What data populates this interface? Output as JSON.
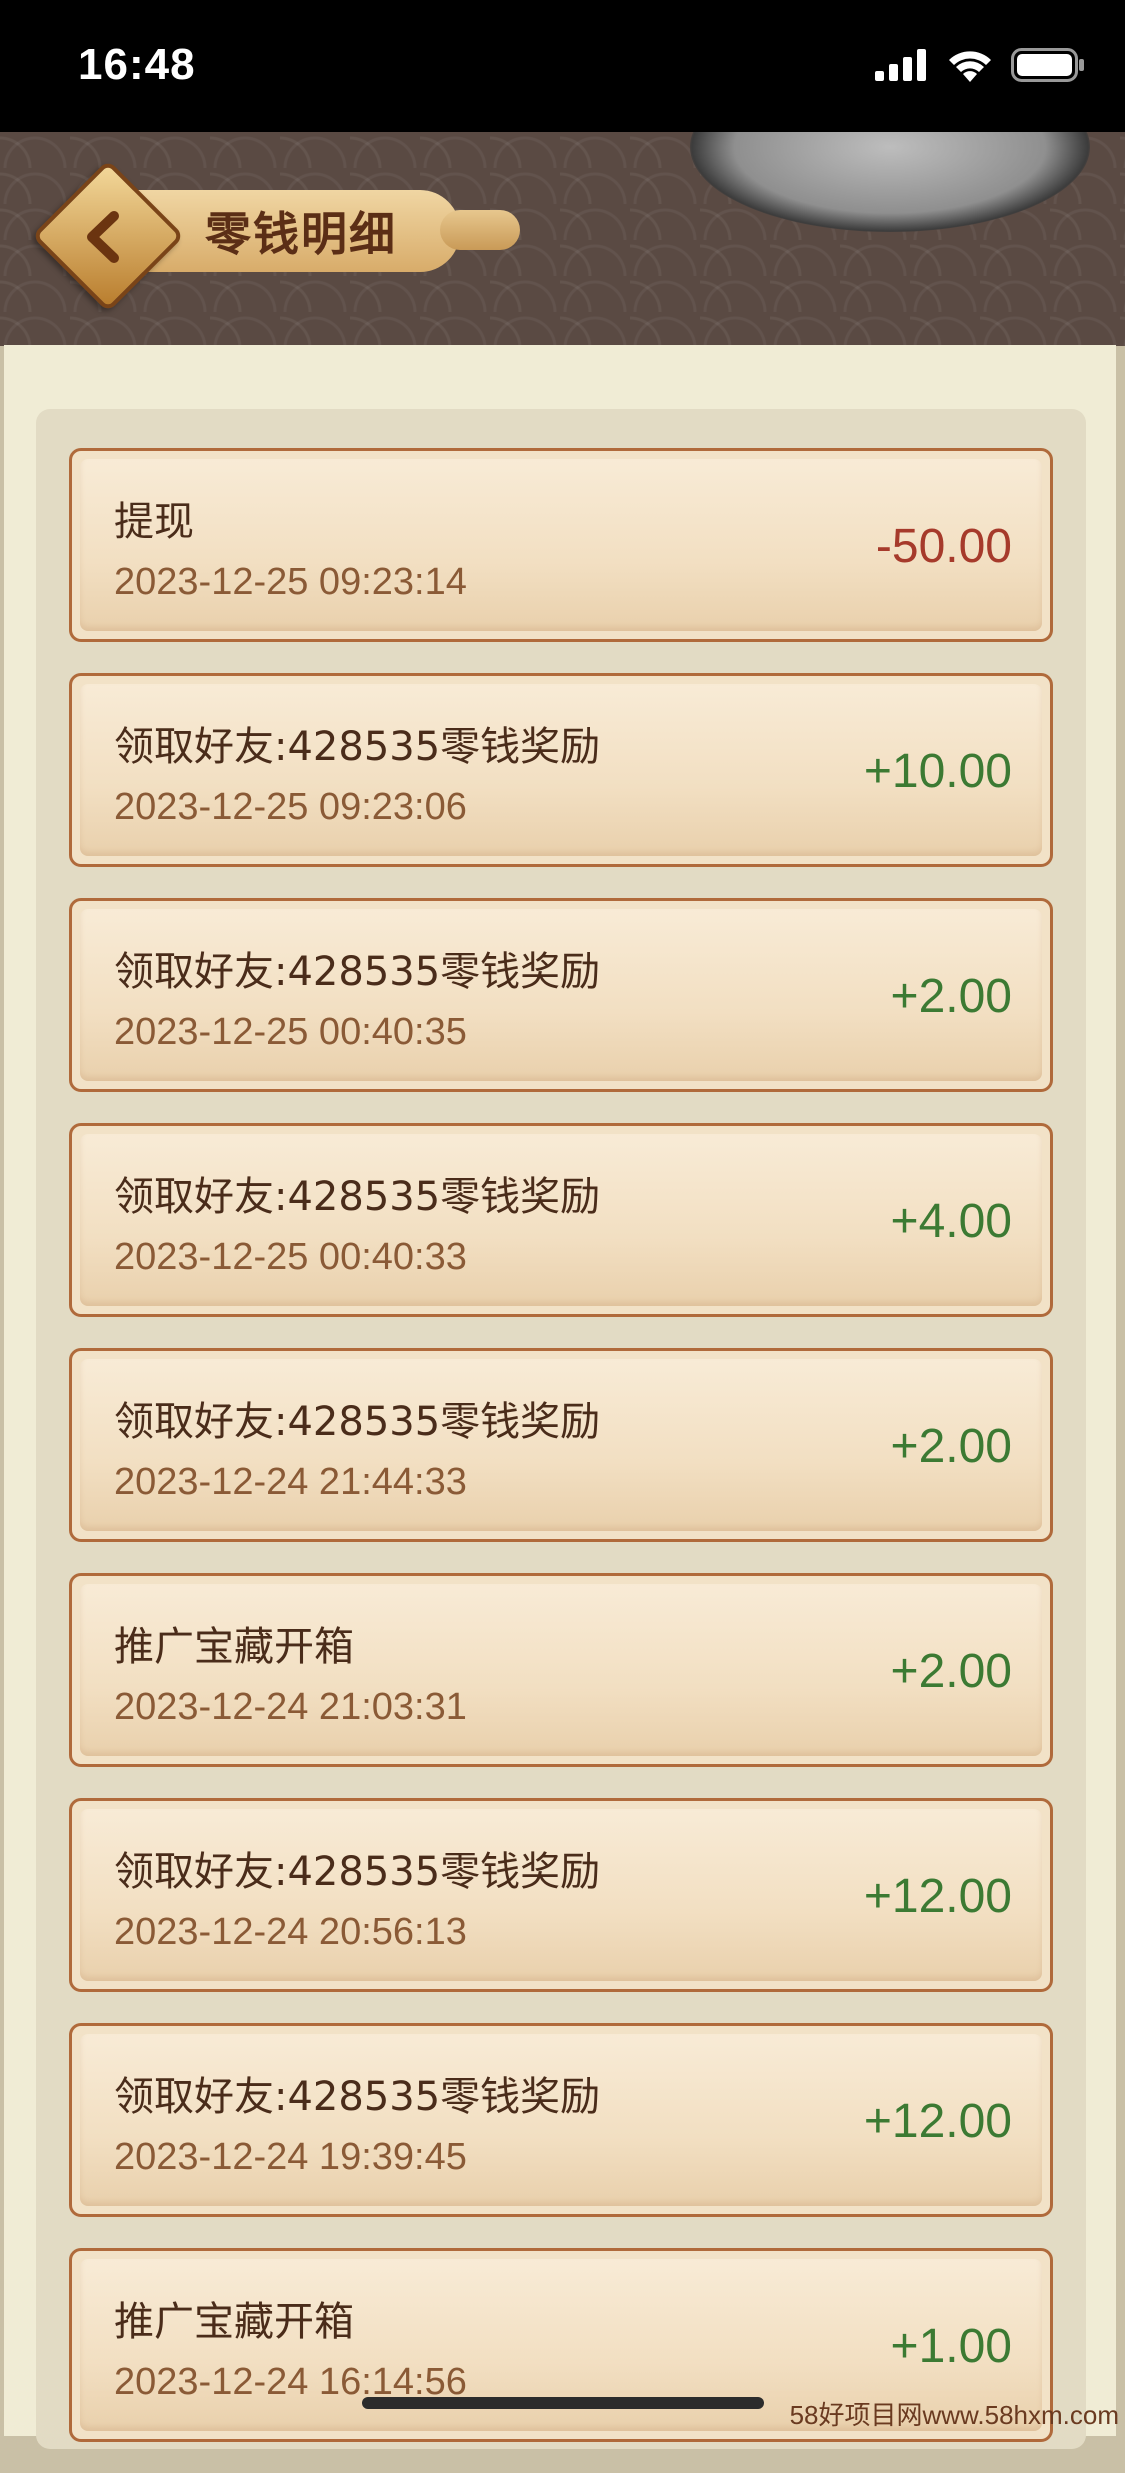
{
  "status_bar": {
    "time": "16:48"
  },
  "header": {
    "title": "零钱明细"
  },
  "colors": {
    "negative": "#a63a2b",
    "positive": "#3c7a33",
    "title": "#5b2e16"
  },
  "transactions": [
    {
      "title": "提现",
      "time": "2023-12-25 09:23:14",
      "amount": "-50.00",
      "sign": "neg"
    },
    {
      "title": "领取好友:428535零钱奖励",
      "time": "2023-12-25 09:23:06",
      "amount": "+10.00",
      "sign": "pos"
    },
    {
      "title": "领取好友:428535零钱奖励",
      "time": "2023-12-25 00:40:35",
      "amount": "+2.00",
      "sign": "pos"
    },
    {
      "title": "领取好友:428535零钱奖励",
      "time": "2023-12-25 00:40:33",
      "amount": "+4.00",
      "sign": "pos"
    },
    {
      "title": "领取好友:428535零钱奖励",
      "time": "2023-12-24 21:44:33",
      "amount": "+2.00",
      "sign": "pos"
    },
    {
      "title": "推广宝藏开箱",
      "time": "2023-12-24 21:03:31",
      "amount": "+2.00",
      "sign": "pos"
    },
    {
      "title": "领取好友:428535零钱奖励",
      "time": "2023-12-24 20:56:13",
      "amount": "+12.00",
      "sign": "pos"
    },
    {
      "title": "领取好友:428535零钱奖励",
      "time": "2023-12-24 19:39:45",
      "amount": "+12.00",
      "sign": "pos"
    },
    {
      "title": "推广宝藏开箱",
      "time": "2023-12-24 16:14:56",
      "amount": "+1.00",
      "sign": "pos"
    }
  ],
  "watermark": "58好项目网www.58hxm.com"
}
